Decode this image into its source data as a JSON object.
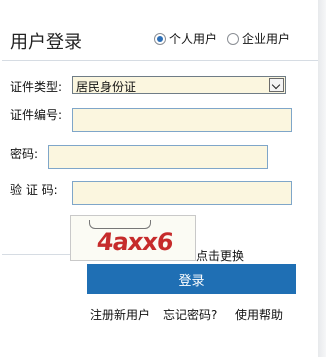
{
  "login": {
    "title": "用户登录",
    "user_types": [
      {
        "label": "个人用户",
        "selected": true
      },
      {
        "label": "企业用户",
        "selected": false
      }
    ],
    "fields": {
      "id_type_label": "证件类型:",
      "id_type_value": "居民身份证",
      "id_number_label": "证件编号:",
      "id_number_value": "",
      "password_label": "密码:",
      "password_value": "",
      "captcha_label": "验 证 码:",
      "captcha_value": ""
    },
    "captcha_text": "4axx6",
    "refresh_label": "点击更换",
    "submit_label": "登录",
    "links": {
      "register": "注册新用户",
      "forgot": "忘记密码?",
      "help": "使用帮助"
    }
  },
  "colors": {
    "button": "#1f6fb4",
    "input_bg": "#fbf6df",
    "captcha_text": "#c62b2b"
  }
}
